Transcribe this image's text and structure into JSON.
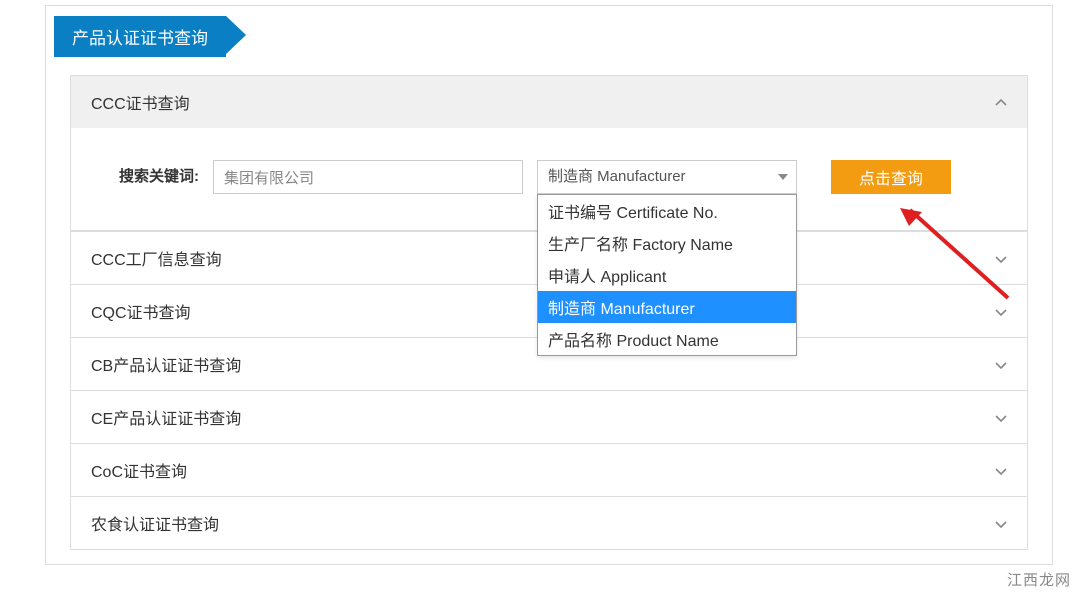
{
  "header": {
    "title": "产品认证证书查询"
  },
  "accordion": {
    "items": [
      {
        "label": "CCC证书查询",
        "expanded": true
      },
      {
        "label": "CCC工厂信息查询",
        "expanded": false
      },
      {
        "label": "CQC证书查询",
        "expanded": false
      },
      {
        "label": "CB产品认证证书查询",
        "expanded": false
      },
      {
        "label": "CE产品认证证书查询",
        "expanded": false
      },
      {
        "label": "CoC证书查询",
        "expanded": false
      },
      {
        "label": "农食认证证书查询",
        "expanded": false
      }
    ]
  },
  "search": {
    "label": "搜索关键词:",
    "input_value": "集团有限公司",
    "select_value": "制造商 Manufacturer",
    "options": [
      {
        "label": "证书编号 Certificate No.",
        "selected": false
      },
      {
        "label": "生产厂名称 Factory Name",
        "selected": false
      },
      {
        "label": "申请人 Applicant",
        "selected": false
      },
      {
        "label": "制造商 Manufacturer",
        "selected": true
      },
      {
        "label": "产品名称 Product Name",
        "selected": false
      }
    ],
    "button_label": "点击查询"
  },
  "watermark": "江西龙网"
}
